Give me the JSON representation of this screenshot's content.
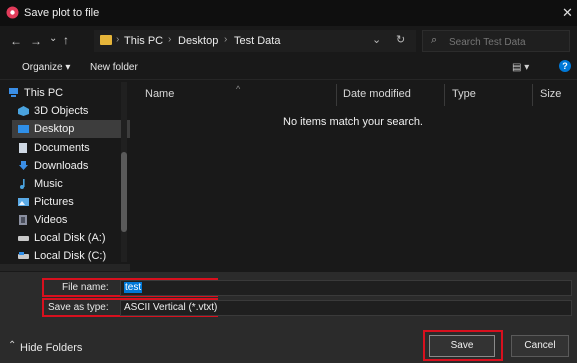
{
  "window": {
    "title": "Save plot to file",
    "close_glyph": "✕"
  },
  "nav": {
    "back": "←",
    "forward": "→",
    "recent": "⌄",
    "up": "↑"
  },
  "address": {
    "crumbs": [
      "This PC",
      "Desktop",
      "Test Data"
    ],
    "sep": "›",
    "dropdown": "⌄",
    "refresh": "↻"
  },
  "search": {
    "placeholder": "Search Test Data",
    "icon": "⌕"
  },
  "toolbar": {
    "organize": "Organize ▾",
    "new_folder": "New folder",
    "view": "▤ ▾",
    "help": "?"
  },
  "sidebar": {
    "items": [
      {
        "label": "This PC",
        "icon": "pc-icon"
      },
      {
        "label": "3D Objects",
        "icon": "cube-icon"
      },
      {
        "label": "Desktop",
        "icon": "desktop-icon"
      },
      {
        "label": "Documents",
        "icon": "document-icon"
      },
      {
        "label": "Downloads",
        "icon": "download-icon"
      },
      {
        "label": "Music",
        "icon": "music-icon"
      },
      {
        "label": "Pictures",
        "icon": "picture-icon"
      },
      {
        "label": "Videos",
        "icon": "video-icon"
      },
      {
        "label": "Local Disk (A:)",
        "icon": "disk-icon"
      },
      {
        "label": "Local Disk (C:)",
        "icon": "disk-icon"
      }
    ],
    "selected": "Desktop"
  },
  "columns": [
    "Name",
    "Date modified",
    "Type",
    "Size"
  ],
  "empty_message": "No items match your search.",
  "form": {
    "filename_label": "File name:",
    "filename_value": "test",
    "savetype_label": "Save as type:",
    "savetype_value": "ASCII Vertical (*.vtxt)"
  },
  "footer": {
    "hide_folders": "Hide Folders",
    "hide_glyph": "⌃",
    "save": "Save",
    "cancel": "Cancel"
  },
  "colors": {
    "highlight": "#d8101e",
    "accent": "#0078d7",
    "folder": "#e6b53a"
  }
}
